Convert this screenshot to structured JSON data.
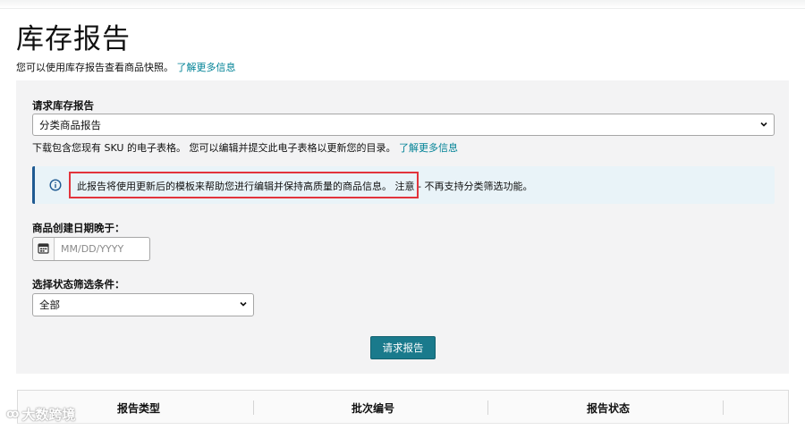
{
  "page": {
    "title": "库存报告",
    "intro_text": "您可以使用库存报告查看商品快照。",
    "intro_link": "了解更多信息"
  },
  "request_form": {
    "report_label": "请求库存报告",
    "report_select_value": "分类商品报告",
    "help_text": "下载包含您现有 SKU 的电子表格。 您可以编辑并提交此电子表格以更新您的目录。",
    "help_link": "了解更多信息",
    "alert_text": "此报告将使用更新后的模板来帮助您进行编辑并保持高质量的商品信息。 注意 - 不再支持分类筛选功能。",
    "date_label": "商品创建日期晚于：",
    "date_placeholder": "MM/DD/YYYY",
    "status_label": "选择状态筛选条件：",
    "status_select_value": "全部",
    "submit_label": "请求报告"
  },
  "table": {
    "columns": [
      "报告类型",
      "批次编号",
      "报告状态"
    ]
  },
  "watermark": {
    "text": "大数跨境"
  },
  "icons": {
    "alert": "info-circle-icon",
    "date": "calendar-icon",
    "select": "chevron-down-icon"
  },
  "colors": {
    "link": "#008296",
    "button": "#1a7a8c",
    "alert_border": "#1f5a92",
    "alert_bg": "#e9f3f8",
    "highlight": "#e2343c"
  }
}
